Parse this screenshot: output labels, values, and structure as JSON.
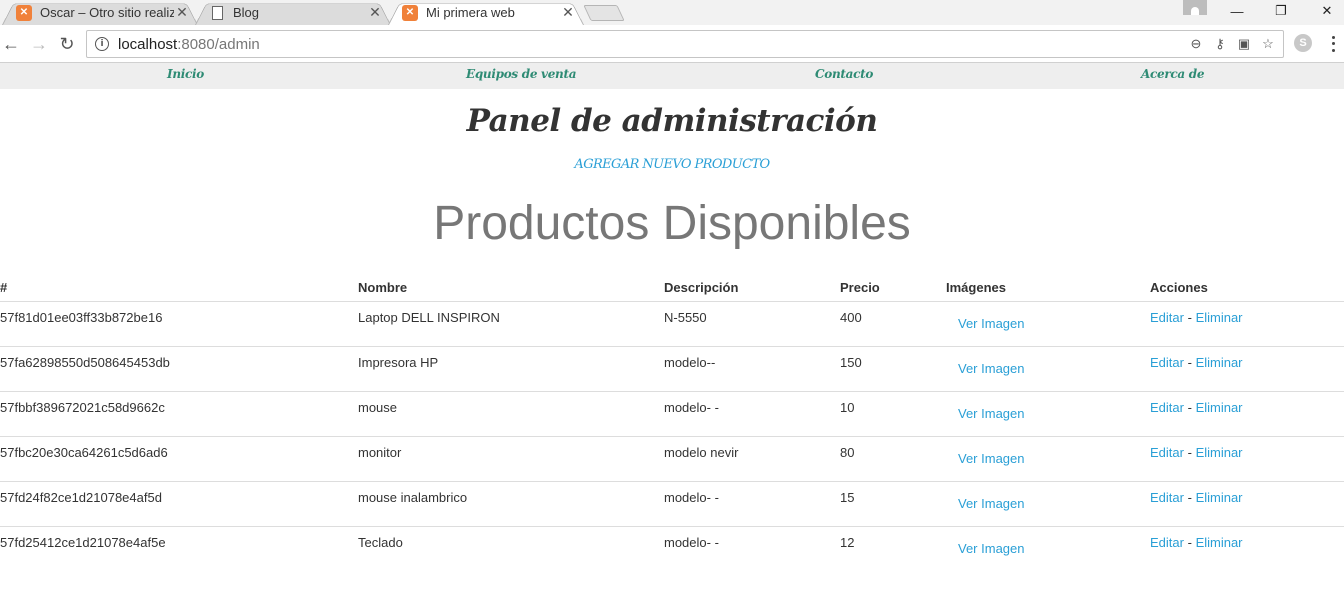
{
  "browser": {
    "tabs": [
      {
        "title": "Oscar – Otro sitio realiza",
        "icon": "xampp-icon"
      },
      {
        "title": "Blog",
        "icon": "document-icon"
      },
      {
        "title": "Mi primera web",
        "icon": "xampp-icon"
      }
    ],
    "url_host": "localhost",
    "url_rest": ":8080/admin"
  },
  "nav": {
    "items": [
      "Inicio",
      "Equipos de venta",
      "Contacto",
      "Acerca de"
    ]
  },
  "page": {
    "panel_title": "Panel de administración",
    "add_product": "AGREGAR NUEVO PRODUCTO",
    "products_title": "Productos Disponibles"
  },
  "table": {
    "headers": [
      "#",
      "Nombre",
      "Descripción",
      "Precio",
      "Imágenes",
      "Acciones"
    ],
    "image_label": "Ver Imagen",
    "edit_label": "Editar",
    "separator": "-",
    "delete_label": "Eliminar",
    "rows": [
      {
        "id": "57f81d01ee03ff33b872be16",
        "name": "Laptop DELL INSPIRON",
        "desc": "N-5550",
        "price": "400"
      },
      {
        "id": "57fa62898550d508645453db",
        "name": "Impresora HP",
        "desc": "modelo--",
        "price": "150"
      },
      {
        "id": "57fbbf389672021c58d9662c",
        "name": "mouse",
        "desc": "modelo- -",
        "price": "10"
      },
      {
        "id": "57fbc20e30ca64261c5d6ad6",
        "name": "monitor",
        "desc": "modelo nevir",
        "price": "80"
      },
      {
        "id": "57fd24f82ce1d21078e4af5d",
        "name": "mouse inalambrico",
        "desc": "modelo- -",
        "price": "15"
      },
      {
        "id": "57fd25412ce1d21078e4af5e",
        "name": "Teclado",
        "desc": "modelo- -",
        "price": "12"
      }
    ]
  }
}
